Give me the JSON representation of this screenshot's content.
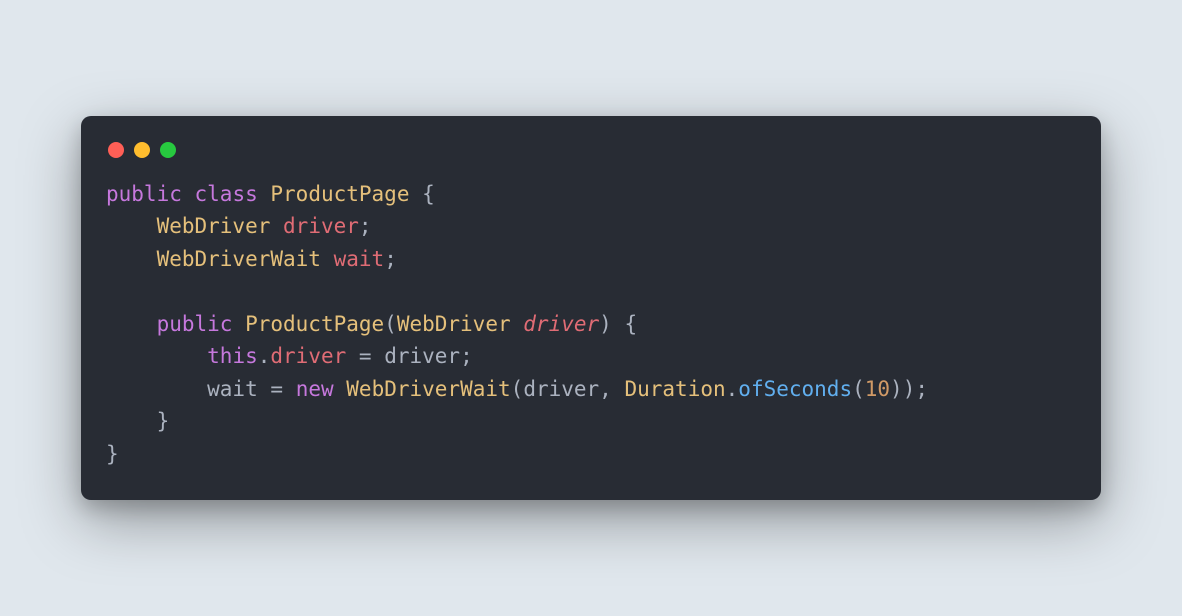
{
  "colors": {
    "background": "#e0e7ed",
    "window_bg": "#282c34",
    "dot_red": "#ff5f56",
    "dot_yellow": "#ffbd2e",
    "dot_green": "#27c93f",
    "keyword": "#c678dd",
    "type": "#e5c07b",
    "field": "#e06c75",
    "method": "#61afef",
    "plain": "#abb2bf",
    "number": "#d19a66"
  },
  "code": {
    "language": "java",
    "plain_text": "public class ProductPage {\n    WebDriver driver;\n    WebDriverWait wait;\n\n    public ProductPage(WebDriver driver) {\n        this.driver = driver;\n        wait = new WebDriverWait(driver, Duration.ofSeconds(10));\n    }\n}",
    "tokens": [
      [
        [
          "keyword",
          "public"
        ],
        [
          "plain",
          " "
        ],
        [
          "keyword",
          "class"
        ],
        [
          "plain",
          " "
        ],
        [
          "type",
          "ProductPage"
        ],
        [
          "plain",
          " "
        ],
        [
          "punc",
          "{"
        ]
      ],
      [
        [
          "plain",
          "    "
        ],
        [
          "type",
          "WebDriver"
        ],
        [
          "plain",
          " "
        ],
        [
          "field",
          "driver"
        ],
        [
          "punc",
          ";"
        ]
      ],
      [
        [
          "plain",
          "    "
        ],
        [
          "type",
          "WebDriverWait"
        ],
        [
          "plain",
          " "
        ],
        [
          "field",
          "wait"
        ],
        [
          "punc",
          ";"
        ]
      ],
      [],
      [
        [
          "plain",
          "    "
        ],
        [
          "keyword",
          "public"
        ],
        [
          "plain",
          " "
        ],
        [
          "type",
          "ProductPage"
        ],
        [
          "punc",
          "("
        ],
        [
          "type",
          "WebDriver"
        ],
        [
          "plain",
          " "
        ],
        [
          "param",
          "driver"
        ],
        [
          "punc",
          ")"
        ],
        [
          "plain",
          " "
        ],
        [
          "punc",
          "{"
        ]
      ],
      [
        [
          "plain",
          "        "
        ],
        [
          "keyword",
          "this"
        ],
        [
          "punc",
          "."
        ],
        [
          "member",
          "driver"
        ],
        [
          "plain",
          " "
        ],
        [
          "punc",
          "="
        ],
        [
          "plain",
          " driver"
        ],
        [
          "punc",
          ";"
        ]
      ],
      [
        [
          "plain",
          "        wait "
        ],
        [
          "punc",
          "="
        ],
        [
          "plain",
          " "
        ],
        [
          "keyword",
          "new"
        ],
        [
          "plain",
          " "
        ],
        [
          "type",
          "WebDriverWait"
        ],
        [
          "punc",
          "("
        ],
        [
          "plain",
          "driver"
        ],
        [
          "punc",
          ","
        ],
        [
          "plain",
          " "
        ],
        [
          "type",
          "Duration"
        ],
        [
          "punc",
          "."
        ],
        [
          "method",
          "ofSeconds"
        ],
        [
          "punc",
          "("
        ],
        [
          "num",
          "10"
        ],
        [
          "punc",
          "))"
        ],
        [
          "punc",
          ";"
        ]
      ],
      [
        [
          "plain",
          "    "
        ],
        [
          "punc",
          "}"
        ]
      ],
      [
        [
          "punc",
          "}"
        ]
      ]
    ]
  }
}
